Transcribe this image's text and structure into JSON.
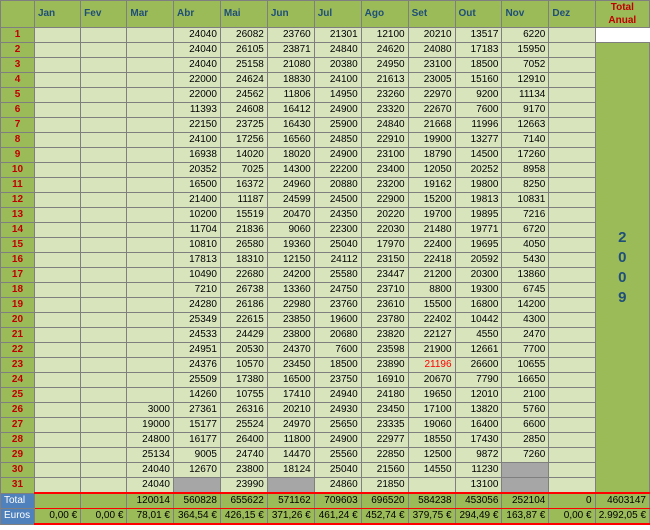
{
  "header": {
    "months": [
      "Jan",
      "Fev",
      "Mar",
      "Abr",
      "Mai",
      "Jun",
      "Jul",
      "Ago",
      "Set",
      "Out",
      "Nov",
      "Dez"
    ],
    "total_label": "Total",
    "total_sub": "Anual"
  },
  "year_digits": [
    "2",
    "0",
    "0",
    "9"
  ],
  "rows": [
    {
      "day": "1",
      "values": [
        "",
        "",
        "",
        "24040",
        "26082",
        "23760",
        "21301",
        "12100",
        "20210",
        "13517",
        "6220",
        ""
      ]
    },
    {
      "day": "2",
      "values": [
        "",
        "",
        "",
        "24040",
        "26105",
        "23871",
        "24840",
        "24620",
        "24080",
        "17183",
        "15950",
        ""
      ]
    },
    {
      "day": "3",
      "values": [
        "",
        "",
        "",
        "24040",
        "25158",
        "21080",
        "20380",
        "24950",
        "23100",
        "18500",
        "7052",
        ""
      ]
    },
    {
      "day": "4",
      "values": [
        "",
        "",
        "",
        "22000",
        "24624",
        "18830",
        "24100",
        "21613",
        "23005",
        "15160",
        "12910",
        ""
      ]
    },
    {
      "day": "5",
      "values": [
        "",
        "",
        "",
        "22000",
        "24562",
        "11806",
        "14950",
        "23260",
        "22970",
        "9200",
        "11134",
        ""
      ]
    },
    {
      "day": "6",
      "values": [
        "",
        "",
        "",
        "11393",
        "24608",
        "16412",
        "24900",
        "23320",
        "22670",
        "7600",
        "9170",
        ""
      ]
    },
    {
      "day": "7",
      "values": [
        "",
        "",
        "",
        "22150",
        "23725",
        "16430",
        "25900",
        "24840",
        "21668",
        "11996",
        "12663",
        ""
      ]
    },
    {
      "day": "8",
      "values": [
        "",
        "",
        "",
        "24100",
        "17256",
        "16560",
        "24850",
        "22910",
        "19900",
        "13277",
        "7140",
        ""
      ]
    },
    {
      "day": "9",
      "values": [
        "",
        "",
        "",
        "16938",
        "14020",
        "18020",
        "24900",
        "23100",
        "18790",
        "14500",
        "17260",
        ""
      ]
    },
    {
      "day": "10",
      "values": [
        "",
        "",
        "",
        "20352",
        "7025",
        "14300",
        "22200",
        "23400",
        "12050",
        "20252",
        "8958",
        ""
      ]
    },
    {
      "day": "11",
      "values": [
        "",
        "",
        "",
        "16500",
        "16372",
        "24960",
        "20880",
        "23200",
        "19162",
        "19800",
        "8250",
        ""
      ]
    },
    {
      "day": "12",
      "values": [
        "",
        "",
        "",
        "21400",
        "11187",
        "24599",
        "24500",
        "22900",
        "15200",
        "19813",
        "10831",
        ""
      ]
    },
    {
      "day": "13",
      "values": [
        "",
        "",
        "",
        "10200",
        "15519",
        "20470",
        "24350",
        "20220",
        "19700",
        "19895",
        "7216",
        ""
      ]
    },
    {
      "day": "14",
      "values": [
        "",
        "",
        "",
        "11704",
        "21836",
        "9060",
        "22300",
        "22030",
        "21480",
        "19771",
        "6720",
        ""
      ]
    },
    {
      "day": "15",
      "values": [
        "",
        "",
        "",
        "10810",
        "26580",
        "19360",
        "25040",
        "17970",
        "22400",
        "19695",
        "4050",
        ""
      ]
    },
    {
      "day": "16",
      "values": [
        "",
        "",
        "",
        "17813",
        "18310",
        "12150",
        "24112",
        "23150",
        "22418",
        "20592",
        "5430",
        ""
      ]
    },
    {
      "day": "17",
      "values": [
        "",
        "",
        "",
        "10490",
        "22680",
        "24200",
        "25580",
        "23447",
        "21200",
        "20300",
        "13860",
        ""
      ]
    },
    {
      "day": "18",
      "values": [
        "",
        "",
        "",
        "7210",
        "26738",
        "13360",
        "24750",
        "23710",
        "8800",
        "19300",
        "6745",
        ""
      ]
    },
    {
      "day": "19",
      "values": [
        "",
        "",
        "",
        "24280",
        "26186",
        "22980",
        "23760",
        "23610",
        "15500",
        "16800",
        "14200",
        ""
      ]
    },
    {
      "day": "20",
      "values": [
        "",
        "",
        "",
        "25349",
        "22615",
        "23850",
        "19600",
        "23780",
        "22402",
        "10442",
        "4300",
        ""
      ]
    },
    {
      "day": "21",
      "values": [
        "",
        "",
        "",
        "24533",
        "24429",
        "23800",
        "20680",
        "23820",
        "22127",
        "4550",
        "2470",
        ""
      ]
    },
    {
      "day": "22",
      "values": [
        "",
        "",
        "",
        "24951",
        "20530",
        "24370",
        "7600",
        "23598",
        "21900",
        "12661",
        "7700",
        ""
      ]
    },
    {
      "day": "23",
      "values": [
        "",
        "",
        "",
        "24376",
        "10570",
        "23450",
        "18500",
        "23890",
        "21196",
        "26600",
        "10655",
        ""
      ]
    },
    {
      "day": "24",
      "values": [
        "",
        "",
        "",
        "25509",
        "17380",
        "16500",
        "23750",
        "16910",
        "20670",
        "7790",
        "16650",
        ""
      ]
    },
    {
      "day": "25",
      "values": [
        "",
        "",
        "",
        "14260",
        "10755",
        "17410",
        "24940",
        "24180",
        "19650",
        "12010",
        "2100",
        ""
      ]
    },
    {
      "day": "26",
      "values": [
        "",
        "",
        "3000",
        "27361",
        "26316",
        "20210",
        "24930",
        "23450",
        "17100",
        "13820",
        "5760",
        ""
      ]
    },
    {
      "day": "27",
      "values": [
        "",
        "",
        "19000",
        "15177",
        "25524",
        "24970",
        "25650",
        "23335",
        "19060",
        "16400",
        "6600",
        ""
      ]
    },
    {
      "day": "28",
      "values": [
        "",
        "",
        "24800",
        "16177",
        "26400",
        "11800",
        "24900",
        "22977",
        "18550",
        "17430",
        "2850",
        ""
      ]
    },
    {
      "day": "29",
      "values": [
        "",
        "",
        "25134",
        "9005",
        "24740",
        "14470",
        "25560",
        "22850",
        "12500",
        "9872",
        "7260",
        ""
      ]
    },
    {
      "day": "30",
      "values": [
        "",
        "",
        "24040",
        "12670",
        "23800",
        "18124",
        "25040",
        "21560",
        "14550",
        "11230",
        "",
        ""
      ]
    },
    {
      "day": "31",
      "values": [
        "",
        "",
        "24040",
        "",
        "23990",
        "",
        "24860",
        "21850",
        "",
        "13100",
        "",
        ""
      ]
    }
  ],
  "totals": {
    "label": "Total",
    "values": [
      "",
      "",
      "120014",
      "560828",
      "655622",
      "571162",
      "709603",
      "696520",
      "584238",
      "453056",
      "252104",
      "0"
    ],
    "annual": "4603147"
  },
  "euros": {
    "label": "Euros",
    "values": [
      "0,00 €",
      "0,00 €",
      "78,01 €",
      "364,54 €",
      "426,15 €",
      "371,26 €",
      "461,24 €",
      "452,74 €",
      "379,75 €",
      "294,49 €",
      "163,87 €",
      "0,00 €"
    ],
    "annual": "2.992,05 €"
  }
}
